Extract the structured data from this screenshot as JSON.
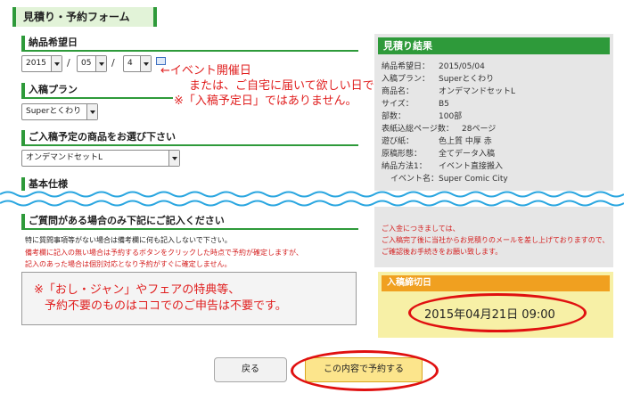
{
  "form": {
    "tab_title": "見積り・予約フォーム",
    "delivery_date": {
      "heading": "納品希望日",
      "year": "2015",
      "month": "05",
      "day": "4",
      "separator": "/"
    },
    "plan": {
      "heading": "入稿プラン",
      "value": "Superとくわり"
    },
    "product": {
      "heading": "ご入稿予定の商品をお選び下さい",
      "value": "オンデマンドセットL"
    },
    "spec": {
      "heading": "基本仕様"
    },
    "questions": {
      "heading": "ご質問がある場合のみ下記にご記入ください",
      "note_black": "特に質問事項等がない場合は備考欄に何も記入しないで下さい。",
      "note_red_1": "備考欄に記入の無い場合は予約するボタンをクリックした時点で予約が確定しますが、",
      "note_red_2": "記入のあった場合は個別対応となり予約がすぐに確定しません。"
    }
  },
  "annotations": {
    "date_line1": "←イベント開催日",
    "date_line2": "または、ご自宅に届いて欲しい日です。",
    "date_line3": "※「入稿予定日」ではありません。",
    "textarea_line1": "※「おし・ジャン」やフェアの特典等、",
    "textarea_line2": "予約不要のものはココでのご申告は不要です。"
  },
  "estimate": {
    "heading": "見積り結果",
    "rows": [
      {
        "k": "納品希望日：",
        "v": "2015/05/04"
      },
      {
        "k": "入稿プラン：",
        "v": "Superとくわり"
      },
      {
        "k": "商品名：",
        "v": "オンデマンドセットL"
      },
      {
        "k": "サイズ：",
        "v": "B5"
      },
      {
        "k": "部数：",
        "v": "100部"
      },
      {
        "k": "表紙込総ページ数：",
        "v": "28ページ"
      },
      {
        "k": "遊び紙：",
        "v": "色上質 中厚 赤"
      },
      {
        "k": "原稿形態：",
        "v": "全てデータ入稿"
      },
      {
        "k": "納品方法1：",
        "v": "イベント直接搬入"
      }
    ],
    "event_label": "イベント名：",
    "event_name": "Super Comic City",
    "note_1": "ご入金につきましては、",
    "note_2": "ご入稿完了後に当社からお見積りのメールを差し上げておりますので、",
    "note_3": "ご確認後お手続きをお願い致します。"
  },
  "deadline": {
    "heading": "入稿締切日",
    "value": "2015年04月21日 09:00"
  },
  "buttons": {
    "back": "戻る",
    "reserve": "この内容で予約する"
  },
  "colors": {
    "accent_green": "#2e9a3a",
    "annotation_red": "#e01010",
    "deadline_orange": "#f0a020",
    "deadline_bg": "#f7f0a6",
    "wave_blue": "#2aa6e0"
  }
}
